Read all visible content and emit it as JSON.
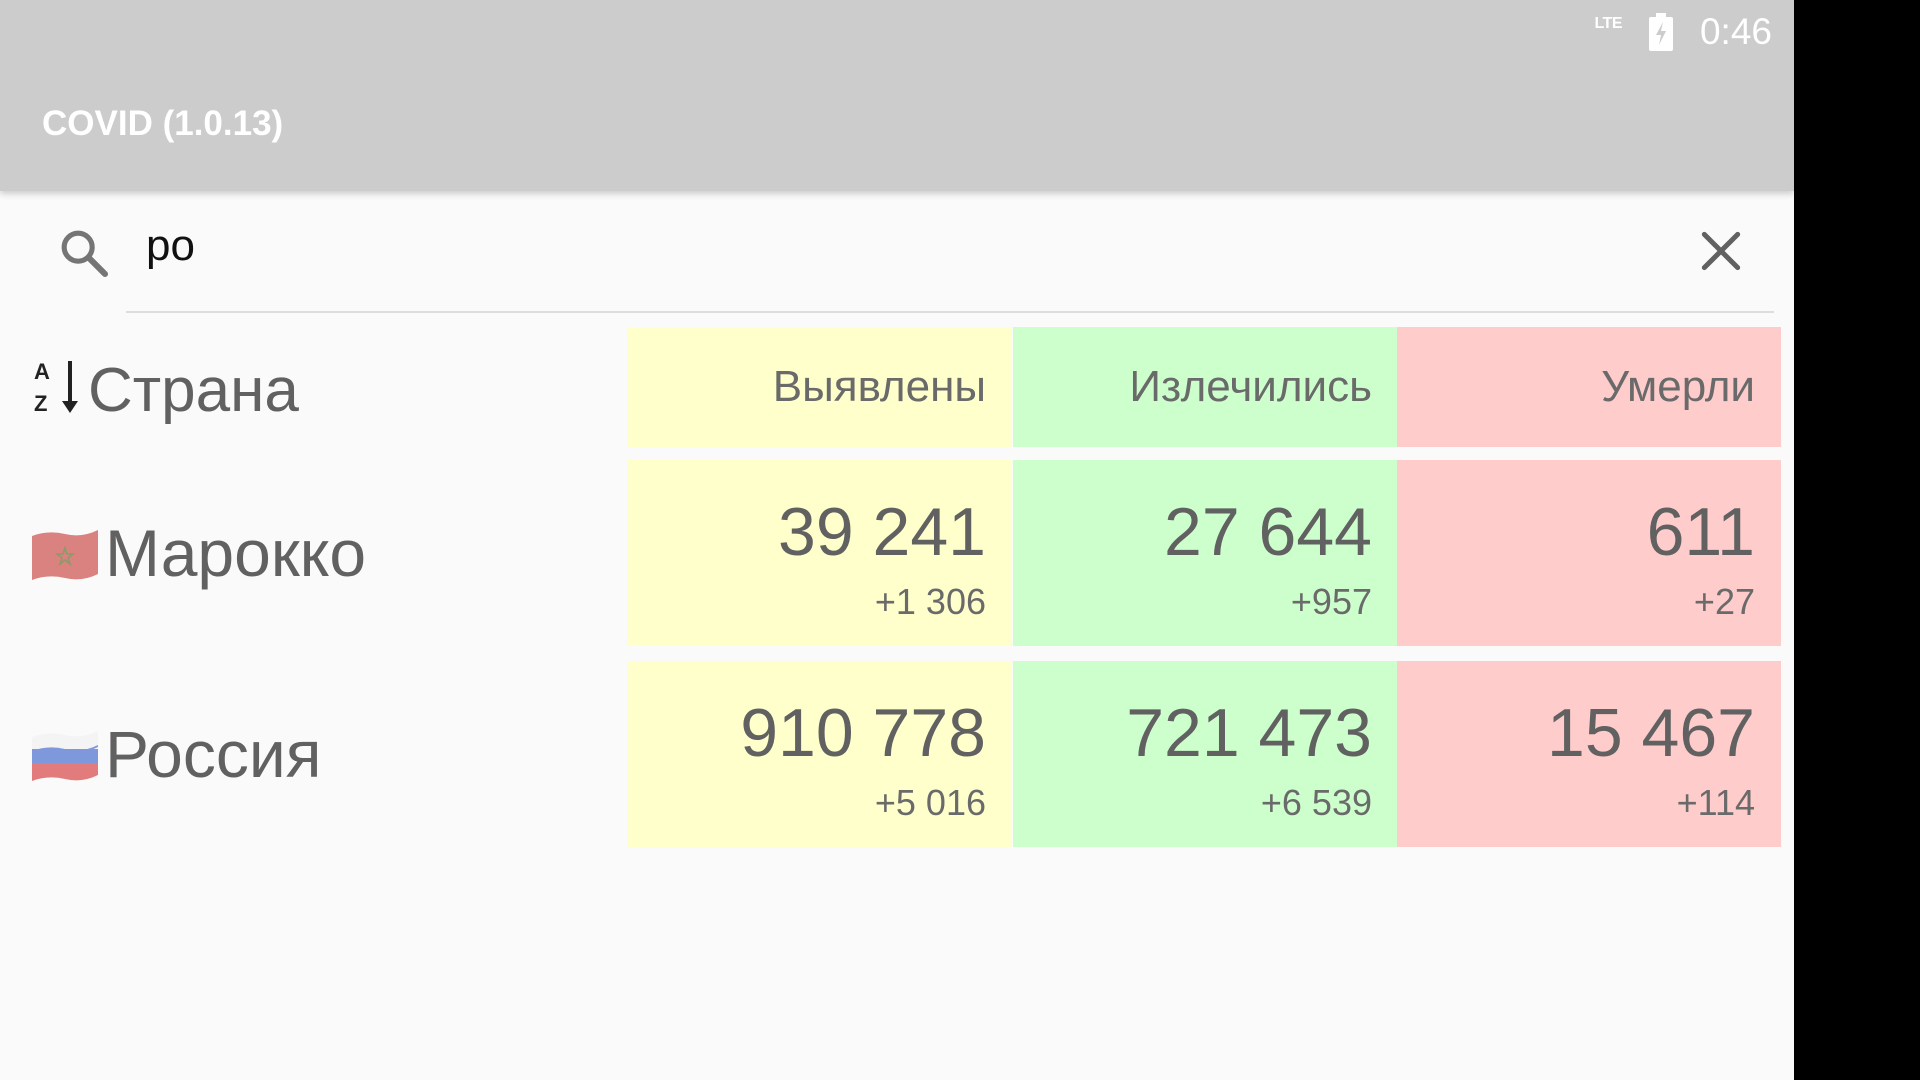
{
  "status_bar": {
    "network": "LTE",
    "time": "0:46"
  },
  "app": {
    "title": "COVID (1.0.13)"
  },
  "search": {
    "value": "ро"
  },
  "table": {
    "country_header": "Страна",
    "headers": {
      "confirmed": "Выявлены",
      "recovered": "Излечились",
      "deaths": "Умерли"
    },
    "rows": [
      {
        "country": "Марокко",
        "flag": "morocco-flag-icon",
        "confirmed": "39 241",
        "confirmed_delta": "+1 306",
        "recovered": "27 644",
        "recovered_delta": "+957",
        "deaths": "611",
        "deaths_delta": "+27"
      },
      {
        "country": "Россия",
        "flag": "russia-flag-icon",
        "confirmed": "910 778",
        "confirmed_delta": "+5 016",
        "recovered": "721 473",
        "recovered_delta": "+6 539",
        "deaths": "15 467",
        "deaths_delta": "+114"
      }
    ]
  },
  "colors": {
    "app_bar": "#cccccc",
    "confirmed_bg": "#ffffcc",
    "recovered_bg": "#ccffcc",
    "deaths_bg": "#ffcccc"
  }
}
